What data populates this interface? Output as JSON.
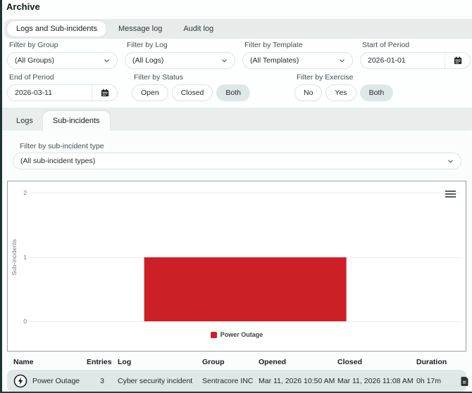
{
  "page": {
    "title": "Archive"
  },
  "top_tabs": [
    {
      "label": "Logs and Sub-incidents",
      "active": true
    },
    {
      "label": "Message log",
      "active": false
    },
    {
      "label": "Audit log",
      "active": false
    }
  ],
  "filters": {
    "group": {
      "label": "Filter by Group",
      "value": "(All Groups)"
    },
    "log": {
      "label": "Filter by Log",
      "value": "(All Logs)"
    },
    "template": {
      "label": "Filter by Template",
      "value": "(All Templates)"
    },
    "start": {
      "label": "Start of Period",
      "value": "2026-01-01"
    },
    "end": {
      "label": "End of Period",
      "value": "2026-03-11"
    },
    "status": {
      "label": "Filter by Status",
      "options": [
        "Open",
        "Closed",
        "Both"
      ],
      "selected": "Both"
    },
    "exercise": {
      "label": "Filter by Exercise",
      "options": [
        "No",
        "Yes",
        "Both"
      ],
      "selected": "Both"
    }
  },
  "sub_tabs": [
    {
      "label": "Logs",
      "active": false
    },
    {
      "label": "Sub-incidents",
      "active": true
    }
  ],
  "subincident_filter": {
    "label": "Filter by sub-incident type",
    "value": "(All sub-incident types)"
  },
  "chart_data": {
    "type": "bar",
    "categories": [
      "Power Outage"
    ],
    "series": [
      {
        "name": "Power Outage",
        "values": [
          1
        ],
        "color": "#cd2026"
      }
    ],
    "title": "",
    "xlabel": "",
    "ylabel": "Sub-incidents",
    "ylim": [
      0,
      2
    ],
    "yticks": [
      0,
      1,
      2
    ],
    "grid": true,
    "legend_position": "bottom",
    "menu_icon": "hamburger-icon"
  },
  "table": {
    "headers": [
      "Name",
      "Entries",
      "Log",
      "Group",
      "Opened",
      "Closed",
      "Duration"
    ],
    "rows": [
      {
        "icon": "lightning-bolt-icon",
        "name": "Power Outage",
        "entries": "3",
        "log": "Cyber security incident",
        "group": "Sentracore INC",
        "opened": "Mar 11, 2026 10:50 AM",
        "closed": "Mar 11, 2026 11:08 AM",
        "duration": "0h 17m",
        "action_icon": "document-icon"
      }
    ]
  },
  "colors": {
    "bar_red": "#cd2026",
    "row_bg": "#dfe8e8",
    "strip_bg": "#e7eceb",
    "active_seg_bg": "#dfe7e8",
    "edge_dark": "#1c3434"
  }
}
